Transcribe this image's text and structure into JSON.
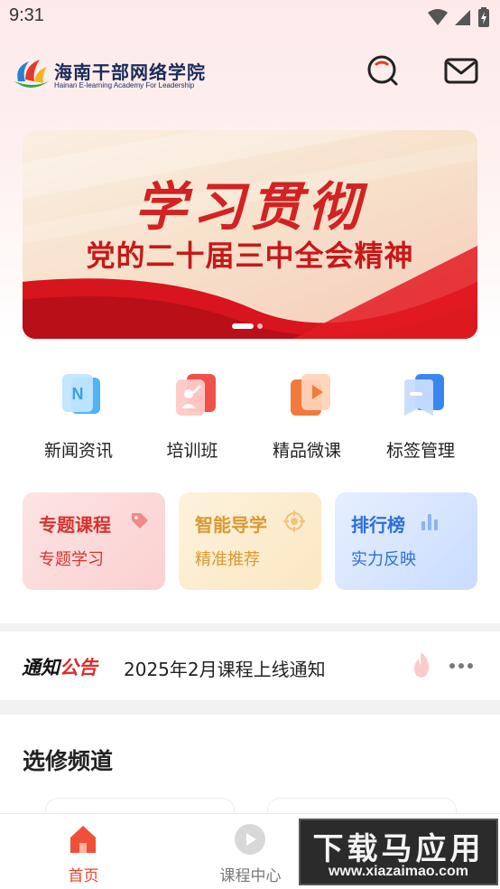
{
  "status_bar": {
    "time": "9:31"
  },
  "header": {
    "title": "海南干部网络学院",
    "subtitle": "Hainan E-learning Academy For Leadership"
  },
  "banner": {
    "script_text": "学习贯彻",
    "headline": "党的二十届三中全会精神",
    "slide_count": 2,
    "active_slide": 1
  },
  "quick_menu": {
    "items": [
      {
        "label": "新闻资讯",
        "icon": "news-icon",
        "color": "#4fb3f5"
      },
      {
        "label": "培训班",
        "icon": "training-class-icon",
        "color": "#f0504a"
      },
      {
        "label": "精品微课",
        "icon": "micro-course-icon",
        "color": "#f27a3a"
      },
      {
        "label": "标签管理",
        "icon": "tag-manage-icon",
        "color": "#3a86f0"
      }
    ]
  },
  "feature_cards": [
    {
      "title": "专题课程",
      "subtitle": "专题学习",
      "icon": "tag-icon",
      "color": "#d5332f"
    },
    {
      "title": "智能导学",
      "subtitle": "精准推荐",
      "icon": "target-icon",
      "color": "#d89a34"
    },
    {
      "title": "排行榜",
      "subtitle": "实力反映",
      "icon": "bar-chart-icon",
      "color": "#2e6fd8"
    }
  ],
  "notice": {
    "tag_part1": "通知",
    "tag_part2": "公告",
    "text": "2025年2月课程上线通知"
  },
  "elective": {
    "title": "选修频道"
  },
  "tabbar": {
    "tabs": [
      {
        "label": "首页",
        "icon": "home-icon",
        "active": true
      },
      {
        "label": "课程中心",
        "icon": "play-icon",
        "active": false
      }
    ]
  },
  "watermark": {
    "title": "下载马应用",
    "url": "www.xiazaimao.com"
  }
}
